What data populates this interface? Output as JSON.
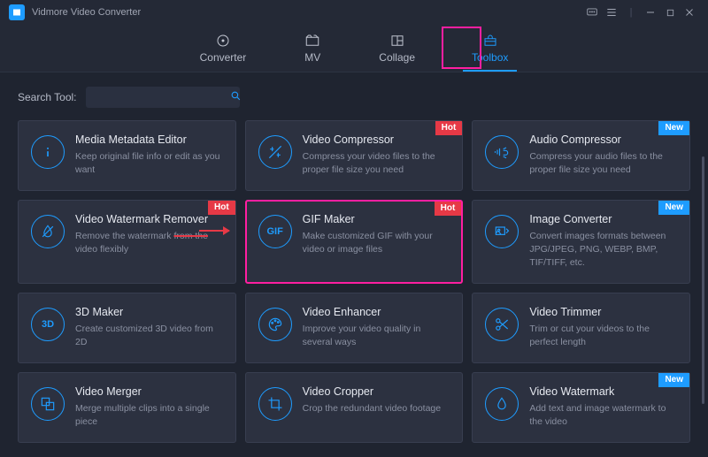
{
  "app": {
    "title": "Vidmore Video Converter"
  },
  "nav": {
    "items": [
      {
        "label": "Converter"
      },
      {
        "label": "MV"
      },
      {
        "label": "Collage"
      },
      {
        "label": "Toolbox"
      }
    ],
    "active": 3
  },
  "search": {
    "label": "Search Tool:",
    "value": ""
  },
  "badges": {
    "hot": "Hot",
    "new": "New"
  },
  "tools": [
    {
      "title": "Media Metadata Editor",
      "desc": "Keep original file info or edit as you want",
      "icon": "info",
      "badge": null
    },
    {
      "title": "Video Compressor",
      "desc": "Compress your video files to the proper file size you need",
      "icon": "compress",
      "badge": "hot"
    },
    {
      "title": "Audio Compressor",
      "desc": "Compress your audio files to the proper file size you need",
      "icon": "audio-compress",
      "badge": "new"
    },
    {
      "title": "Video Watermark Remover",
      "desc_pre": "Remove the watermark ",
      "desc_strike": "from the",
      "desc_post": " video flexibly",
      "icon": "droplet",
      "badge": "hot"
    },
    {
      "title": "GIF Maker",
      "desc": "Make customized GIF with your video or image files",
      "icon": "gif",
      "badge": "hot",
      "selected": true
    },
    {
      "title": "Image Converter",
      "desc": "Convert images formats between JPG/JPEG, PNG, WEBP, BMP, TIF/TIFF, etc.",
      "icon": "image-convert",
      "badge": "new"
    },
    {
      "title": "3D Maker",
      "desc": "Create customized 3D video from 2D",
      "icon": "3d",
      "badge": null
    },
    {
      "title": "Video Enhancer",
      "desc": "Improve your video quality in several ways",
      "icon": "palette",
      "badge": null
    },
    {
      "title": "Video Trimmer",
      "desc": "Trim or cut your videos to the perfect length",
      "icon": "scissors",
      "badge": null
    },
    {
      "title": "Video Merger",
      "desc": "Merge multiple clips into a single piece",
      "icon": "merge",
      "badge": null
    },
    {
      "title": "Video Cropper",
      "desc": "Crop the redundant video footage",
      "icon": "crop",
      "badge": null
    },
    {
      "title": "Video Watermark",
      "desc": "Add text and image watermark to the video",
      "icon": "drop-add",
      "badge": "new"
    }
  ]
}
